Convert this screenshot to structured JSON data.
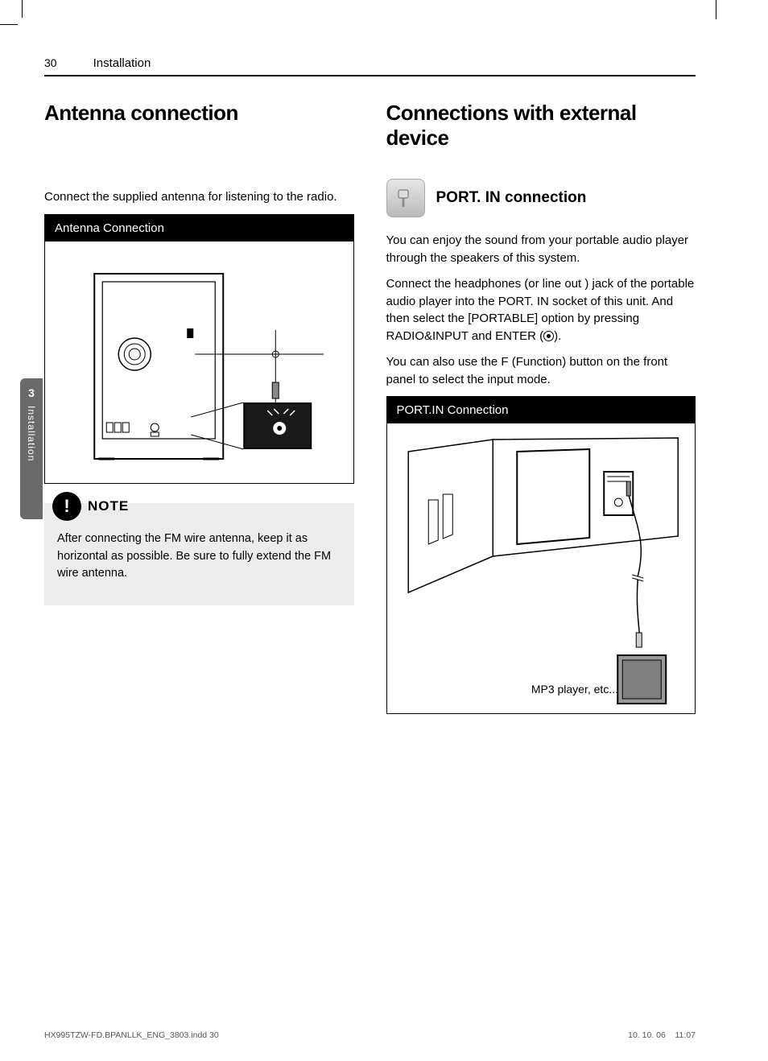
{
  "header": {
    "page_number": "30",
    "section": "Installation"
  },
  "side_tab": {
    "number": "3",
    "label": "Installation"
  },
  "left": {
    "title": "Antenna connection",
    "intro": "Connect the supplied antenna for listening to the radio.",
    "figure_title": "Antenna Connection",
    "note_label": "NOTE",
    "note_text": "After connecting the FM wire antenna, keep it as horizontal as possible. Be sure to fully extend the FM wire antenna."
  },
  "right": {
    "title": "Connections with external device",
    "portin_title": "PORT. IN connection",
    "p1": "You can enjoy the sound from your portable audio player through the speakers of this system.",
    "p2a": "Connect the headphones (or line out ) jack of the portable audio player into the PORT. IN socket of this unit. And then select the [PORTABLE] option by pressing RADIO&INPUT and ENTER (",
    "p2b": ").",
    "p3": "You can also use the F (Function) button on the front panel to select the input mode.",
    "figure_title": "PORT.IN Connection",
    "mp3_label": "MP3 player, etc..."
  },
  "footer": {
    "filename": "HX995TZW-FD.BPANLLK_ENG_3803.indd   30",
    "date": "10. 10. 06",
    "time": "11:07"
  }
}
